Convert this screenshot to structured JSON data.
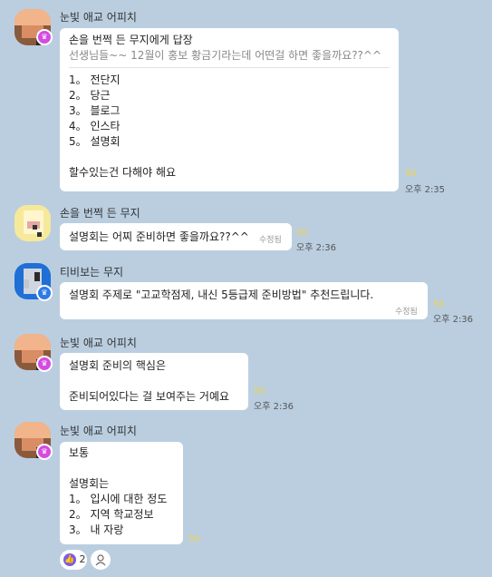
{
  "messages": [
    {
      "sender": "눈빛 애교 어피치",
      "reply_title": "손을 번쩍 든 무지에게 답장",
      "reply_quote": "선생님들~~ 12월이 홍보 황금기라는데 어떤걸 하면 좋을까요??^^",
      "lines": [
        "1。 전단지",
        "2。 당근",
        "3。 블로그",
        "4。 인스타",
        "5。 설명회",
        "",
        "할수있는건 다해야 해요"
      ],
      "count": "50",
      "time": "오후 2:35"
    },
    {
      "sender": "손을 번쩍 든 무지",
      "lines": [
        "설명회는 어찌 준비하면 좋을까요??^^"
      ],
      "edited": "수정됨",
      "count": "50",
      "time": "오후 2:36"
    },
    {
      "sender": "티비보는 무지",
      "lines": [
        "설명회 주제로 \"고교학점제, 내신 5등급제 준비방법\" 추천드립니다."
      ],
      "edited": "수정됨",
      "count": "50",
      "time": "오후 2:36"
    },
    {
      "sender": "눈빛 애교 어피치",
      "lines": [
        "설명회 준비의 핵심은",
        "",
        "준비되어있다는 걸 보여주는 거예요"
      ],
      "count": "50",
      "time": "오후 2:36"
    },
    {
      "sender": "눈빛 애교 어피치",
      "lines": [
        "보통",
        "",
        "설명회는",
        "1。 입시에 대한 정도",
        "2。 지역 학교정보",
        "3。 내 자랑"
      ],
      "count": "50",
      "reaction_count": "2"
    }
  ],
  "icons": {
    "badge": "crown-icon",
    "reaction": "thumbs-up-icon",
    "add_reaction": "person-icon"
  },
  "colors": {
    "background": "#bacee0",
    "bubble": "#ffffff",
    "unread_count": "#f3d24c",
    "badge_pink": "#d44ce0",
    "badge_blue": "#2d7be6"
  }
}
